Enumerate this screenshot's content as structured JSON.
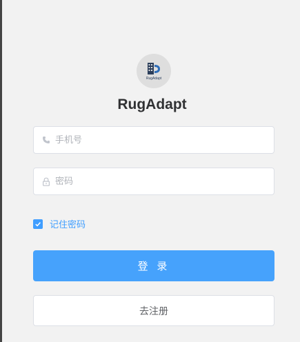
{
  "app": {
    "name": "RugAdapt",
    "logo_text": "RugAdapt"
  },
  "form": {
    "phone": {
      "placeholder": "手机号",
      "value": "",
      "icon": "phone-icon"
    },
    "password": {
      "placeholder": "密码",
      "value": "",
      "icon": "lock-icon"
    },
    "remember": {
      "label": "记住密码",
      "checked": true
    }
  },
  "buttons": {
    "login_label": "登 录",
    "register_label": "去注册"
  },
  "colors": {
    "primary": "#409eff",
    "login_button": "#46a2fc",
    "background": "#f2f2f2",
    "title": "#303133"
  }
}
